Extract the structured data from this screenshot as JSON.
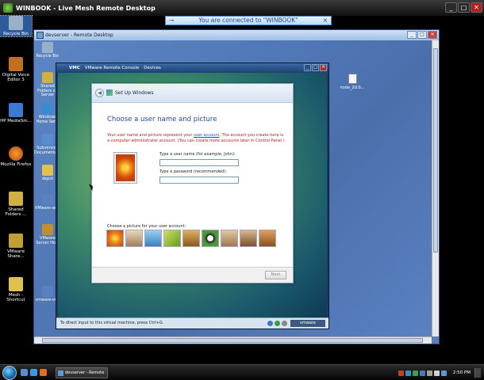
{
  "mesh": {
    "title": "WINBOOK - Live Mesh Remote Desktop",
    "connected": "You are connected to \"WINBOOK\"",
    "controls": [
      "_",
      "□",
      "✕"
    ]
  },
  "host_desktop": {
    "icons": [
      {
        "label": "Recycle Bin",
        "color": "#9ab0c8"
      },
      {
        "label": "Digital Voice Editor 3",
        "color": "#c07020"
      },
      {
        "label": "HP MediaSm...",
        "color": "#3a7ad0"
      },
      {
        "label": "Mozilla Firefox",
        "color": "#e07020"
      },
      {
        "label": "Shared Folders ...",
        "color": "#d0b040"
      },
      {
        "label": "VMware Share...",
        "color": "#c0a030"
      },
      {
        "label": "Mesh - Shortcut",
        "color": "#e0c050"
      }
    ]
  },
  "remote_window": {
    "title": "devserver - Remote Desktop",
    "controls": [
      "_",
      "□",
      "✕"
    ]
  },
  "remote_desktop": {
    "icons": [
      {
        "label": "Recycle Bin",
        "color": "#9ab0c8"
      },
      {
        "label": "Shared Folders on Server",
        "color": "#d0b040"
      },
      {
        "label": "Windows Home Ser...",
        "color": "#3a8ad0"
      },
      {
        "label": "Subversion Documentati...",
        "color": "#5a8ad0"
      },
      {
        "label": "depot",
        "color": "#e0c050"
      },
      {
        "label": "VMware-se...",
        "color": "#5a80c0"
      },
      {
        "label": "VMware Server Ho...",
        "color": "#c09030"
      },
      {
        "label": "vmware-vmr",
        "color": "#5a80c0"
      }
    ],
    "file_label": "node_2d.0..."
  },
  "vmc": {
    "app": "VMC",
    "menu": [
      "VMware Remote Console",
      "Devices"
    ],
    "controls": [
      "_",
      "□",
      "✕"
    ],
    "status": "To direct input to this virtual machine, press Ctrl+G.",
    "brand": "vmware"
  },
  "setup": {
    "title": "Set Up Windows",
    "heading": "Choose a user name and picture",
    "desc_1": "Your user name and picture represent your ",
    "desc_link": "user account",
    "desc_2": ". The account you create here is a computer administrator account. (You can create more accounts later in Control Panel.)",
    "username_label": "Type a user name (for example, John):",
    "password_label": "Type a password (recommended):",
    "choose_label": "Choose a picture for your user account:",
    "next": "Next",
    "pictures": [
      {
        "name": "flower-picture",
        "color": "#f07a1a"
      },
      {
        "name": "robot-picture",
        "color": "#c0a070"
      },
      {
        "name": "bird-picture",
        "color": "#60a0d0"
      },
      {
        "name": "leaves-picture",
        "color": "#a0c040"
      },
      {
        "name": "guitar-picture",
        "color": "#d09030"
      },
      {
        "name": "soccer-picture",
        "color": "#4a9a3a"
      },
      {
        "name": "dog-picture",
        "color": "#c0a070"
      },
      {
        "name": "owl-picture",
        "color": "#b08050"
      },
      {
        "name": "cat-picture",
        "color": "#c08040"
      }
    ]
  },
  "taskbar": {
    "task": "devserver - Remote ...",
    "clock": "2:50 PM"
  }
}
